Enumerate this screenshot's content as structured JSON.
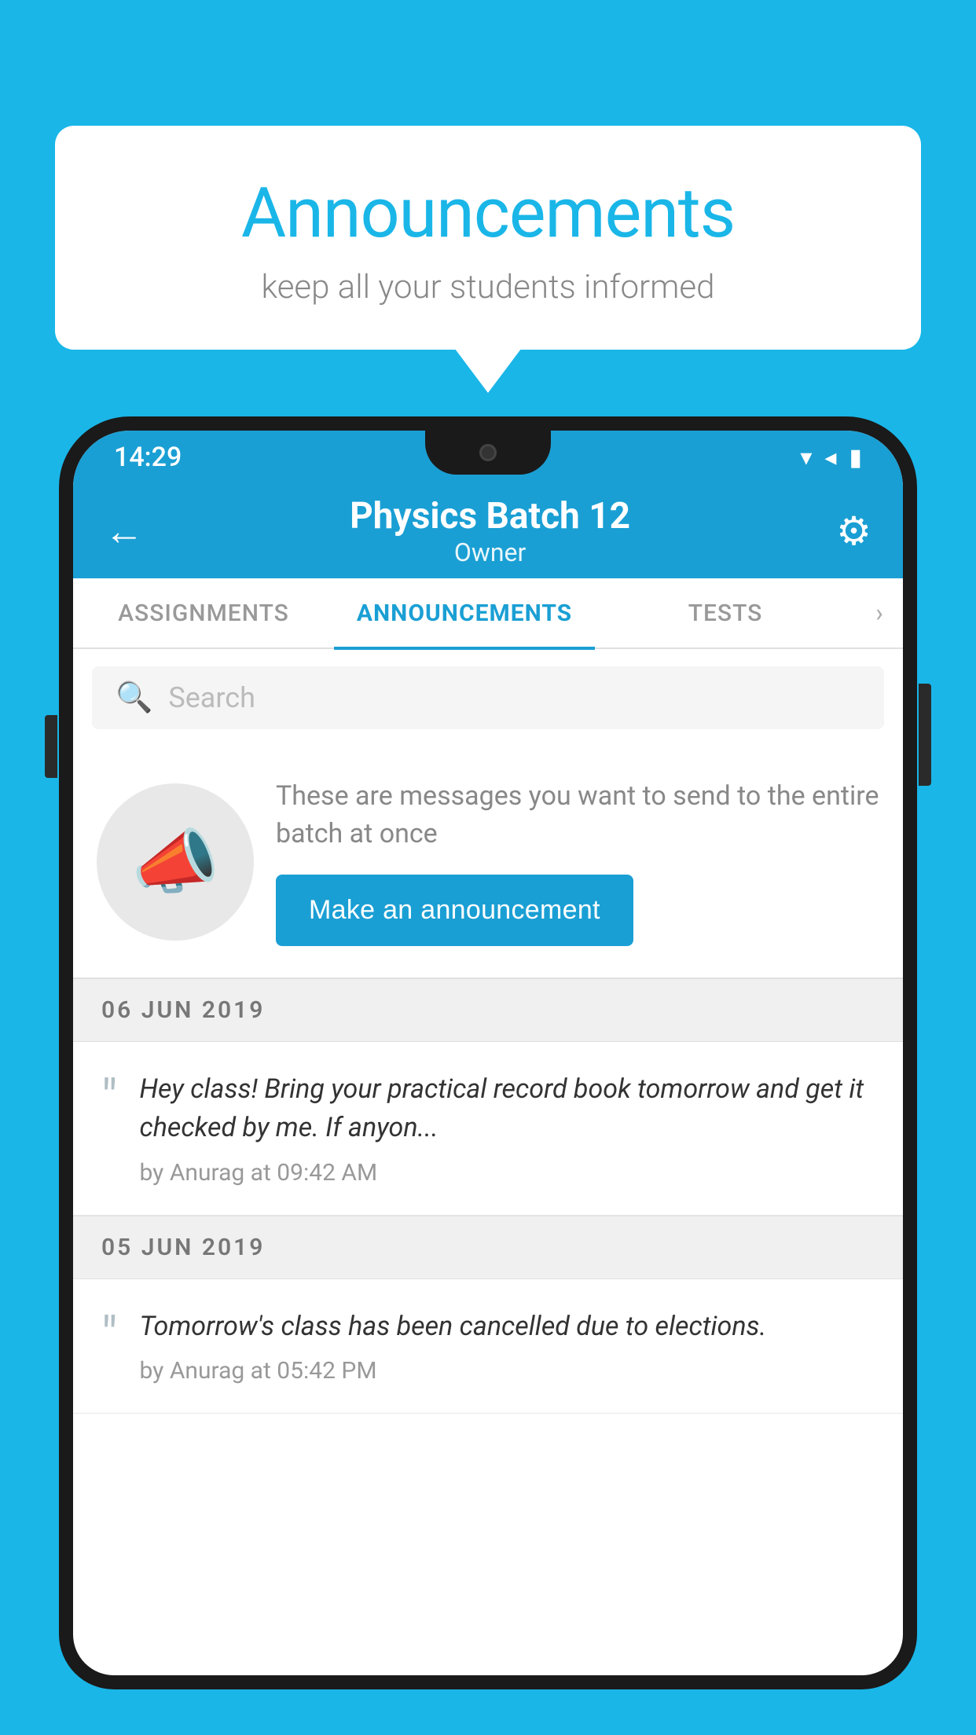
{
  "background_color": "#1ab6e8",
  "bubble": {
    "title": "Announcements",
    "subtitle": "keep all your students informed"
  },
  "phone": {
    "status_bar": {
      "time": "14:29",
      "wifi": "▼",
      "signal": "▲",
      "battery": "▮"
    },
    "app_bar": {
      "title": "Physics Batch 12",
      "subtitle": "Owner",
      "back_label": "←",
      "settings_label": "⚙"
    },
    "tabs": [
      {
        "label": "ASSIGNMENTS",
        "active": false
      },
      {
        "label": "ANNOUNCEMENTS",
        "active": true
      },
      {
        "label": "TESTS",
        "active": false
      }
    ],
    "search": {
      "placeholder": "Search"
    },
    "promo": {
      "description": "These are messages you want to send to the entire batch at once",
      "button_label": "Make an announcement"
    },
    "announcements": [
      {
        "date": "06  JUN  2019",
        "text": "Hey class! Bring your practical record book tomorrow and get it checked by me. If anyon...",
        "meta": "by Anurag at 09:42 AM"
      },
      {
        "date": "05  JUN  2019",
        "text": "Tomorrow's class has been cancelled due to elections.",
        "meta": "by Anurag at 05:42 PM"
      }
    ]
  }
}
